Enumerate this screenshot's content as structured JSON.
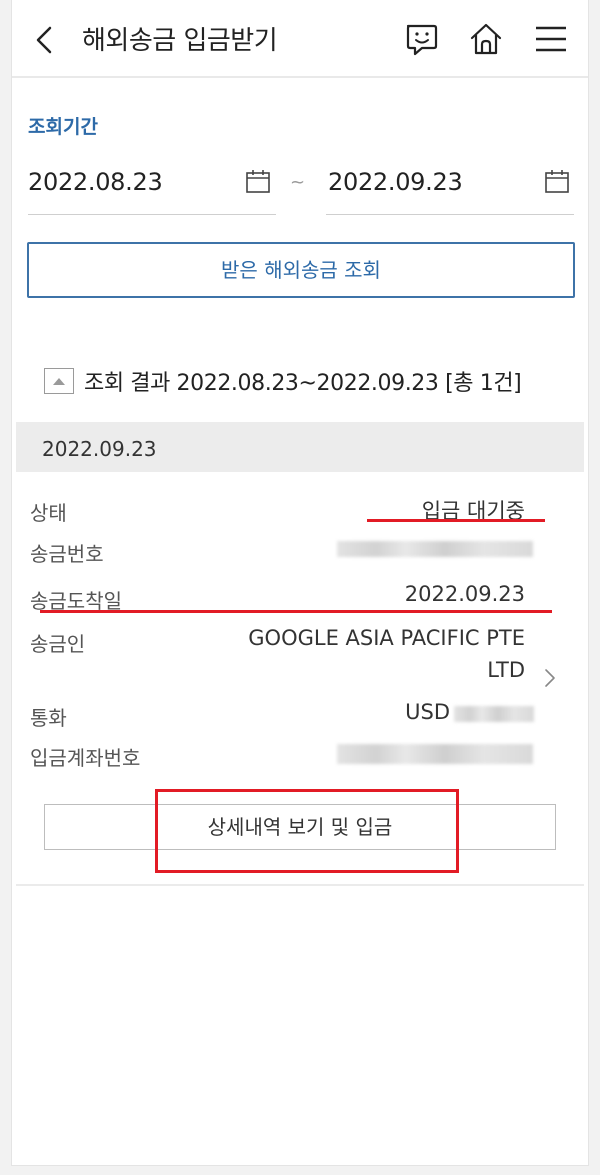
{
  "header": {
    "title": "해외송금 입금받기",
    "icons": [
      "chevron-left-icon",
      "chat-icon",
      "home-icon",
      "menu-icon"
    ]
  },
  "period": {
    "label": "조회기간",
    "start_date": "2022.08.23",
    "separator": "~",
    "end_date": "2022.09.23"
  },
  "search_button": {
    "label": "받은 해외송금 조회"
  },
  "results": {
    "summary": "조회 결과 2022.08.23~2022.09.23 [총 1건]",
    "date": "2022.09.23",
    "rows": [
      {
        "label": "상태",
        "value": "입금 대기중"
      },
      {
        "label": "송금번호",
        "value": ""
      },
      {
        "label": "송금도착일",
        "value": "2022.09.23"
      },
      {
        "label": "송금인",
        "value_line1": "GOOGLE ASIA PACIFIC PTE",
        "value_line2": "LTD"
      },
      {
        "label": "통화",
        "value": "USD"
      },
      {
        "label": "입금계좌번호",
        "value": ""
      }
    ],
    "detail_button": {
      "label": "상세내역 보기 및 입금"
    }
  },
  "colors": {
    "accent": "#2d6aa8",
    "annotation": "#e21b25"
  }
}
